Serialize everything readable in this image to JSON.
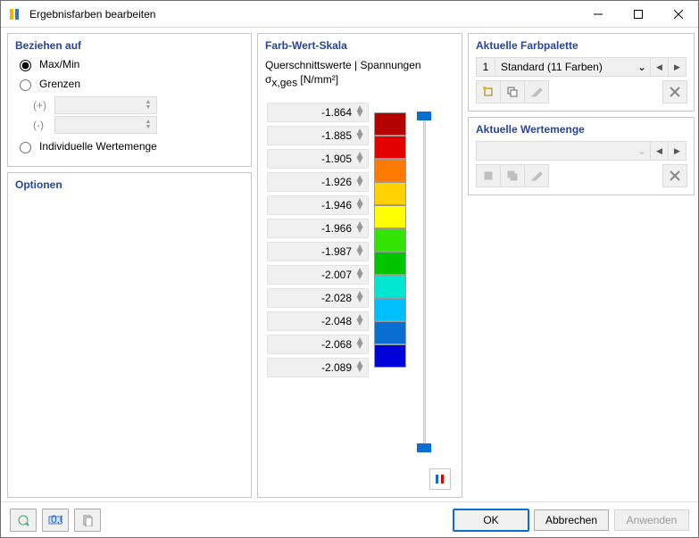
{
  "window": {
    "title": "Ergebnisfarben bearbeiten"
  },
  "left": {
    "heading": "Beziehen auf",
    "opt_maxmin": "Max/Min",
    "opt_limits": "Grenzen",
    "plus": "(+)",
    "minus": "(-)",
    "opt_individual": "Individuelle Wertemenge",
    "options_heading": "Optionen"
  },
  "mid": {
    "heading": "Farb-Wert-Skala",
    "subtitle": "Querschnittswerte | Spannungen",
    "unit_html": "σ",
    "unit_sub": "x,ges",
    "unit_tail": " [N/mm²]",
    "values": [
      "-1.864",
      "-1.885",
      "-1.905",
      "-1.926",
      "-1.946",
      "-1.966",
      "-1.987",
      "-2.007",
      "-2.028",
      "-2.048",
      "-2.068",
      "-2.089"
    ],
    "colors": [
      "#b50000",
      "#e30000",
      "#ff7a00",
      "#ffd200",
      "#ffff00",
      "#34e400",
      "#00c400",
      "#00e6d0",
      "#00bfff",
      "#0a6ed1",
      "#0000d8"
    ]
  },
  "right": {
    "pal_heading": "Aktuelle Farbpalette",
    "pal_num": "1",
    "pal_name": "Standard (11 Farben)",
    "set_heading": "Aktuelle Wertemenge"
  },
  "footer": {
    "ok": "OK",
    "cancel": "Abbrechen",
    "apply": "Anwenden"
  }
}
